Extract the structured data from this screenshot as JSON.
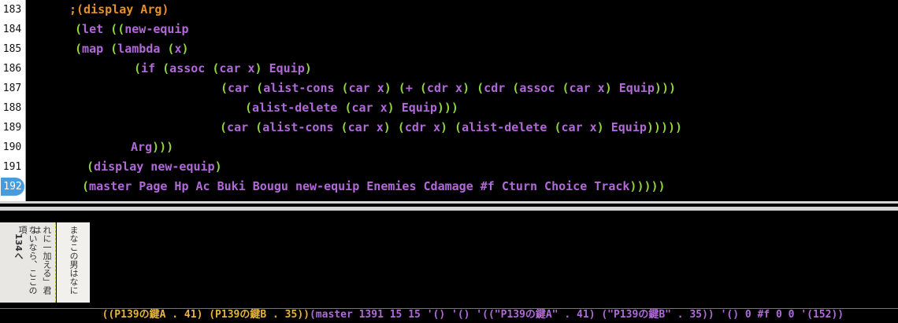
{
  "line_numbers": [
    "183",
    "184",
    "185",
    "186",
    "187",
    "188",
    "189",
    "190",
    "191",
    "192"
  ],
  "lines": [
    "  ;(display Arg)",
    "   (let ((new-equip",
    "   (map (lambda (x)",
    "      (if (assoc (car x) Equip)",
    "         (car (alist-cons (car x) (+ (cdr x) (cdr (assoc (car x) Equip)))",
    "            (alist-delete (car x) Equip)))",
    "        (car (alist-cons (car x) (cdr x) (alist-delete (car x) Equip)))))",
    "      Arg)))",
    "    (display new-equip)",
    "    (master Page Hp Ac Buki Bougu new-equip Enemies Cdamage #f Cturn Choice Track)))))"
  ],
  "output": {
    "alist": "((P139の鍵A . 41) (P139の鍵B . 35))",
    "master": "(master 1391 15 15 '() '() '((\"P139の鍵A\" . 41) (\"P139の鍵B\" . 35)) '() 0 #f 0 0 '(152))"
  },
  "image_text": {
    "img1_col1": "れに一加える」君は",
    "img1_col2": "ないなら、ここの項",
    "img1_col3": "134へ",
    "img2_col1": "まなこの男はなに"
  },
  "colors": {
    "comment": "#e8902a",
    "paren": "#8fd43a",
    "symbol": "#b06ad8",
    "output_alist": "#e8b33a",
    "output_master": "#b06ad8",
    "current_line": "#4a9bdc"
  }
}
